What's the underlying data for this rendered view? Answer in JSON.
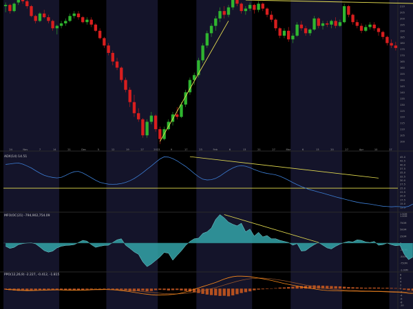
{
  "theme": {
    "background": "#000000",
    "band_color": "#14142a",
    "up_color": "#2fb52f",
    "down_color": "#d81e1e",
    "trendline_color": "#e8e051",
    "adx_line_color": "#3d7fd6",
    "mfo_fill_color": "#33a3a8",
    "ppo_hist_color": "#b4501f",
    "ppo_line_color": "#ff8c1a",
    "ppo_signal_color": "#a05a2a",
    "axis_text_color": "#9a9a9a",
    "divider_color": "#2a2a2a"
  },
  "chart_data": [
    {
      "id": "price",
      "type": "candlestick",
      "title": "",
      "ylim": [
        95,
        215
      ],
      "y_ticks": [
        100,
        105,
        110,
        115,
        120,
        125,
        130,
        135,
        140,
        145,
        150,
        155,
        160,
        165,
        170,
        175,
        180,
        185,
        190,
        195,
        200,
        205,
        210
      ],
      "x_tick_labels": [
        "24",
        "Nov",
        "7",
        "14",
        "21",
        "Dec",
        "5",
        "12",
        "19",
        "27",
        "2023",
        "9",
        "17",
        "23",
        "Feb",
        "6",
        "13",
        "21",
        "27",
        "Mar",
        "6",
        "13",
        "20",
        "27",
        "Apr",
        "10",
        "17"
      ],
      "month_bands": [
        [
          0,
          13
        ],
        [
          24,
          36
        ],
        [
          45,
          58
        ],
        [
          67,
          79
        ],
        [
          90,
          102
        ]
      ],
      "candles": [
        [
          210,
          213,
          205,
          211
        ],
        [
          211,
          212,
          204,
          206
        ],
        [
          206,
          213,
          205,
          212
        ],
        [
          213,
          217,
          211,
          216
        ],
        [
          216,
          219,
          212,
          214
        ],
        [
          214,
          216,
          208,
          210
        ],
        [
          210,
          211,
          201,
          202
        ],
        [
          202,
          203,
          196,
          198
        ],
        [
          198,
          205,
          197,
          204
        ],
        [
          204,
          207,
          200,
          201
        ],
        [
          201,
          203,
          196,
          198
        ],
        [
          198,
          199,
          190,
          192
        ],
        [
          192,
          195,
          187,
          194
        ],
        [
          194,
          198,
          192,
          196
        ],
        [
          196,
          200,
          194,
          198
        ],
        [
          198,
          204,
          197,
          202
        ],
        [
          202,
          206,
          200,
          204
        ],
        [
          204,
          206,
          199,
          201
        ],
        [
          201,
          202,
          196,
          197
        ],
        [
          197,
          201,
          195,
          199
        ],
        [
          199,
          201,
          193,
          195
        ],
        [
          195,
          196,
          189,
          190
        ],
        [
          190,
          192,
          183,
          184
        ],
        [
          184,
          185,
          176,
          178
        ],
        [
          178,
          180,
          170,
          172
        ],
        [
          172,
          174,
          162,
          165
        ],
        [
          165,
          168,
          158,
          160
        ],
        [
          160,
          161,
          148,
          150
        ],
        [
          150,
          152,
          140,
          142
        ],
        [
          142,
          144,
          128,
          132
        ],
        [
          132,
          138,
          120,
          123
        ],
        [
          123,
          127,
          116,
          118
        ],
        [
          118,
          119,
          103,
          105
        ],
        [
          105,
          118,
          103,
          116
        ],
        [
          116,
          124,
          114,
          121
        ],
        [
          121,
          122,
          108,
          110
        ],
        [
          110,
          112,
          98,
          102
        ],
        [
          102,
          112,
          101,
          110
        ],
        [
          110,
          118,
          109,
          116
        ],
        [
          116,
          124,
          113,
          122
        ],
        [
          122,
          128,
          118,
          120
        ],
        [
          120,
          132,
          119,
          130
        ],
        [
          130,
          142,
          128,
          140
        ],
        [
          140,
          152,
          138,
          150
        ],
        [
          150,
          156,
          146,
          154
        ],
        [
          154,
          168,
          152,
          166
        ],
        [
          166,
          180,
          164,
          178
        ],
        [
          178,
          190,
          176,
          188
        ],
        [
          188,
          196,
          185,
          194
        ],
        [
          194,
          202,
          190,
          200
        ],
        [
          200,
          209,
          197,
          206
        ],
        [
          206,
          210,
          200,
          203
        ],
        [
          203,
          211,
          201,
          209
        ],
        [
          209,
          217,
          207,
          215
        ],
        [
          215,
          218,
          210,
          212
        ],
        [
          212,
          213,
          204,
          206
        ],
        [
          206,
          210,
          203,
          208
        ],
        [
          208,
          213,
          206,
          211
        ],
        [
          211,
          212,
          204,
          207
        ],
        [
          207,
          214,
          205,
          212
        ],
        [
          212,
          213,
          206,
          208
        ],
        [
          208,
          209,
          201,
          203
        ],
        [
          203,
          206,
          197,
          199
        ],
        [
          199,
          200,
          190,
          192
        ],
        [
          192,
          193,
          184,
          186
        ],
        [
          186,
          192,
          184,
          190
        ],
        [
          190,
          193,
          181,
          183
        ],
        [
          183,
          188,
          180,
          186
        ],
        [
          186,
          197,
          185,
          195
        ],
        [
          195,
          198,
          190,
          192
        ],
        [
          192,
          194,
          186,
          188
        ],
        [
          188,
          192,
          186,
          191
        ],
        [
          191,
          202,
          190,
          200
        ],
        [
          200,
          201,
          192,
          194
        ],
        [
          194,
          198,
          191,
          196
        ],
        [
          196,
          198,
          193,
          195
        ],
        [
          195,
          199,
          192,
          198
        ],
        [
          198,
          201,
          192,
          194
        ],
        [
          194,
          199,
          193,
          197
        ],
        [
          197,
          212,
          196,
          210
        ],
        [
          210,
          211,
          201,
          203
        ],
        [
          203,
          204,
          195,
          197
        ],
        [
          197,
          199,
          192,
          194
        ],
        [
          194,
          196,
          188,
          190
        ],
        [
          190,
          195,
          189,
          193
        ],
        [
          193,
          197,
          191,
          195
        ],
        [
          195,
          197,
          190,
          192
        ],
        [
          192,
          193,
          186,
          189
        ],
        [
          189,
          190,
          183,
          185
        ],
        [
          185,
          186,
          178,
          180
        ],
        [
          180,
          183,
          176,
          178
        ],
        [
          178,
          181,
          174,
          176
        ]
      ],
      "trendlines": [
        {
          "from": [
            36,
            100
          ],
          "to": [
            52,
            198
          ]
        },
        {
          "from": [
            56,
            215
          ],
          "to": [
            98,
            212
          ]
        }
      ]
    },
    {
      "id": "adx",
      "type": "line",
      "label": "ADX(14) 14.51",
      "ylim": [
        10,
        48
      ],
      "y_ticks": [
        12.5,
        15.0,
        17.5,
        20.0,
        22.5,
        25.0,
        27.5,
        30.0,
        32.5,
        35.0,
        37.5,
        40.0,
        42.5,
        45.0
      ],
      "reference_line": 25.0,
      "values": [
        40.3,
        40.6,
        41.0,
        41.2,
        40.5,
        39.3,
        38.0,
        36.3,
        34.7,
        33.3,
        32.5,
        31.9,
        31.6,
        32.0,
        33.2,
        34.6,
        35.6,
        35.8,
        34.8,
        33.3,
        31.7,
        30.1,
        28.8,
        28.1,
        27.6,
        27.5,
        27.6,
        28.0,
        28.7,
        29.8,
        31.2,
        33.0,
        35.0,
        37.2,
        39.3,
        41.6,
        43.8,
        45.2,
        45.0,
        44.0,
        42.6,
        40.8,
        39.0,
        36.8,
        34.5,
        32.4,
        30.8,
        30.3,
        30.5,
        31.3,
        32.8,
        34.7,
        36.5,
        38.0,
        39.1,
        39.5,
        39.1,
        38.2,
        37.0,
        36.0,
        35.1,
        34.5,
        34.1,
        33.6,
        32.7,
        31.5,
        30.1,
        28.6,
        27.3,
        26.0,
        25.0,
        24.0,
        23.3,
        22.5,
        21.8,
        21.0,
        20.2,
        19.4,
        18.7,
        18.0,
        17.3,
        16.6,
        16.0,
        15.5,
        15.1,
        14.8,
        14.3,
        13.8,
        13.4,
        13.2,
        13.0,
        13.2,
        13.1,
        12.8,
        13.3,
        14.8
      ],
      "trendlines": [
        {
          "from": [
            43,
            45.3
          ],
          "to": [
            87,
            31.5
          ]
        }
      ]
    },
    {
      "id": "mfo",
      "type": "area",
      "label": "MFO(OC(21) -794,902,754.09",
      "ylim": [
        -1050,
        1150
      ],
      "y_ticks": [
        "1.50M",
        "1.00M",
        "750M",
        "500M",
        "250M",
        "0",
        "-250M",
        "-500M",
        "-750M",
        "-1.00M"
      ],
      "values": [
        -120,
        -200,
        -160,
        -60,
        -20,
        0,
        10,
        -30,
        -150,
        -280,
        -340,
        -300,
        -180,
        -120,
        -90,
        -80,
        -60,
        20,
        100,
        70,
        -60,
        -160,
        -120,
        -90,
        -80,
        20,
        120,
        160,
        -80,
        -200,
        -330,
        -420,
        -700,
        -880,
        -780,
        -650,
        -520,
        -350,
        -380,
        -640,
        -460,
        -290,
        -90,
        60,
        160,
        180,
        360,
        420,
        560,
        880,
        1060,
        940,
        780,
        700,
        640,
        740,
        420,
        520,
        260,
        400,
        230,
        280,
        160,
        160,
        100,
        60,
        20,
        -80,
        -20,
        -300,
        -280,
        -160,
        -60,
        20,
        -80,
        -180,
        -220,
        -120,
        -40,
        20,
        60,
        40,
        120,
        100,
        40,
        20,
        60,
        -80,
        -60,
        0,
        -60,
        -100,
        -80,
        -420,
        -620,
        -520
      ],
      "trendlines": [
        {
          "from": [
            51,
            1060
          ],
          "to": [
            73,
            20
          ]
        }
      ]
    },
    {
      "id": "ppo",
      "type": "histogram_with_lines",
      "label": "PPO(12,26,9) -2.227, -0.412, -1.815",
      "ylim": [
        -12,
        9
      ],
      "y_ticks": [
        "8",
        "6",
        "4",
        "2",
        "0",
        "-2",
        "-4",
        "-6",
        "-8",
        "-10"
      ],
      "histogram": [
        -0.6,
        -0.9,
        -1.1,
        -1.3,
        -1.2,
        -1.4,
        -1.2,
        -1.0,
        -0.8,
        -0.7,
        -0.6,
        -0.5,
        -0.6,
        -0.8,
        -1.0,
        -1.1,
        -1.0,
        -1.0,
        -0.9,
        -0.6,
        -0.4,
        -0.2,
        -0.1,
        -0.3,
        -0.4,
        -0.6,
        -0.8,
        -1.0,
        -1.2,
        -1.5,
        -1.6,
        -1.5,
        -1.2,
        -1.6,
        -1.4,
        -0.9,
        -0.7,
        -0.8,
        -1.1,
        -0.9,
        -0.8,
        -1.1,
        -1.4,
        -1.8,
        -2.2,
        -2.6,
        -3.1,
        -3.5,
        -3.8,
        -4.0,
        -4.3,
        -4.2,
        -4.5,
        -4.0,
        -3.3,
        -2.6,
        -2.1,
        -1.6,
        -1.0,
        -0.6,
        -0.4,
        -0.3,
        -0.1,
        0.3,
        0.6,
        0.7,
        0.9,
        1.1,
        1.3,
        1.5,
        1.6,
        1.8,
        1.9,
        1.8,
        1.7,
        1.6,
        1.5,
        1.4,
        1.3,
        1.1,
        0.9,
        0.8,
        0.7,
        0.6,
        0.5,
        0.6,
        0.6,
        0.6,
        0.4,
        0.5,
        0.4,
        0.3,
        0.2,
        -0.6,
        -1.0,
        -1.2
      ],
      "ppo_line": [
        -0.5,
        -0.6,
        -0.8,
        -1.0,
        -1.1,
        -1.2,
        -1.2,
        -1.1,
        -1.0,
        -0.9,
        -0.8,
        -0.7,
        -0.7,
        -0.8,
        -0.9,
        -1.0,
        -1.0,
        -1.0,
        -0.9,
        -0.8,
        -0.6,
        -0.5,
        -0.4,
        -0.5,
        -0.6,
        -0.7,
        -0.9,
        -1.2,
        -1.5,
        -1.8,
        -2.2,
        -2.6,
        -3.0,
        -3.3,
        -3.6,
        -3.8,
        -3.8,
        -3.7,
        -3.6,
        -3.4,
        -3.1,
        -2.6,
        -2.0,
        -1.2,
        -0.4,
        0.4,
        1.2,
        2.0,
        2.8,
        3.6,
        4.6,
        5.6,
        6.4,
        7.0,
        7.3,
        7.3,
        7.2,
        7.0,
        6.6,
        6.2,
        5.8,
        5.3,
        4.8,
        4.2,
        3.6,
        3.0,
        2.5,
        2.0,
        1.5,
        1.0,
        0.6,
        0.2,
        -0.2,
        -0.6,
        -0.9,
        -1.1,
        -1.2,
        -1.3,
        -1.4,
        -1.4,
        -1.5,
        -1.5,
        -1.5,
        -1.6,
        -1.6,
        -1.6,
        -1.7,
        -1.7,
        -1.8,
        -1.9,
        -2.0,
        -2.1,
        -2.2,
        -2.4,
        -2.8,
        -2.9
      ],
      "signal_line": [
        -0.4,
        -0.5,
        -0.6,
        -0.7,
        -0.8,
        -0.9,
        -1.0,
        -1.0,
        -1.0,
        -1.0,
        -0.9,
        -0.9,
        -0.8,
        -0.8,
        -0.8,
        -0.9,
        -0.9,
        -0.9,
        -0.9,
        -0.9,
        -0.8,
        -0.7,
        -0.7,
        -0.6,
        -0.6,
        -0.6,
        -0.7,
        -0.8,
        -0.9,
        -1.0,
        -1.2,
        -1.4,
        -1.7,
        -2.0,
        -2.2,
        -2.5,
        -2.7,
        -2.9,
        -3.0,
        -3.1,
        -3.1,
        -3.0,
        -2.8,
        -2.5,
        -2.1,
        -1.7,
        -1.2,
        -0.6,
        0.0,
        0.6,
        1.3,
        2.1,
        2.9,
        3.6,
        4.3,
        4.9,
        5.4,
        5.8,
        6.0,
        6.2,
        6.2,
        6.0,
        5.8,
        5.4,
        5.0,
        4.6,
        4.1,
        3.6,
        3.1,
        2.6,
        2.1,
        1.6,
        1.1,
        0.7,
        0.3,
        0.0,
        -0.3,
        -0.5,
        -0.7,
        -0.9,
        -1.0,
        -1.1,
        -1.2,
        -1.3,
        -1.4,
        -1.4,
        -1.5,
        -1.5,
        -1.6,
        -1.6,
        -1.7,
        -1.8,
        -1.9,
        -2.0,
        -2.1,
        -2.2
      ]
    }
  ]
}
